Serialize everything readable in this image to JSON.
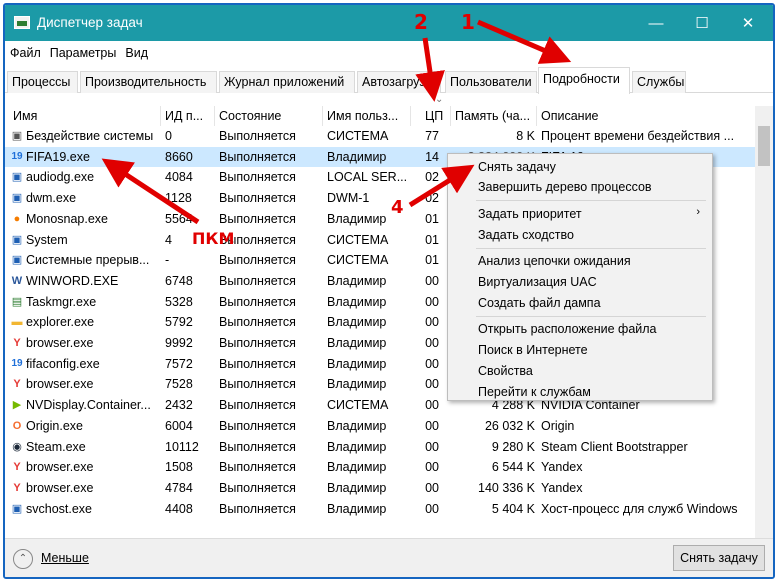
{
  "window": {
    "title": "Диспетчер задач"
  },
  "menu": [
    "Файл",
    "Параметры",
    "Вид"
  ],
  "tabs": [
    "Процессы",
    "Производительность",
    "Журнал приложений",
    "Автозагрузка",
    "Пользователи",
    "Подробности",
    "Службы"
  ],
  "active_tab": "Подробности",
  "columns": {
    "name": "Имя",
    "pid": "ИД п...",
    "state": "Состояние",
    "user": "Имя польз...",
    "cpu": "ЦП",
    "mem": "Память (ча...",
    "desc": "Описание"
  },
  "rows": [
    {
      "name": "Бездействие системы",
      "pid": "0",
      "state": "Выполняется",
      "user": "СИСТЕМА",
      "cpu": "77",
      "mem": "8 K",
      "desc": "Процент времени бездействия ...",
      "icon": "system-idle-icon"
    },
    {
      "name": "FIFA19.exe",
      "pid": "8660",
      "state": "Выполняется",
      "user": "Владимир",
      "cpu": "14",
      "mem": "",
      "desc": "",
      "icon": "fifa-icon"
    },
    {
      "name": "audiodg.exe",
      "pid": "4084",
      "state": "Выполняется",
      "user": "LOCAL SER...",
      "cpu": "02",
      "mem": "",
      "desc": "ойст...",
      "icon": "window-icon"
    },
    {
      "name": "dwm.exe",
      "pid": "1128",
      "state": "Выполняется",
      "user": "DWM-1",
      "cpu": "02",
      "mem": "",
      "desc": "ола",
      "icon": "window-icon"
    },
    {
      "name": "Monosnap.exe",
      "pid": "5564",
      "state": "Выполняется",
      "user": "Владимир",
      "cpu": "01",
      "mem": "",
      "desc": "",
      "icon": "monosnap-icon"
    },
    {
      "name": "System",
      "pid": "4",
      "state": "Выполняется",
      "user": "СИСТЕМА",
      "cpu": "01",
      "mem": "",
      "desc": "",
      "icon": "window-icon"
    },
    {
      "name": "Системные прерыв...",
      "pid": "-",
      "state": "Выполняется",
      "user": "СИСТЕМА",
      "cpu": "01",
      "mem": "",
      "desc": "дур ...",
      "icon": "window-icon"
    },
    {
      "name": "WINWORD.EXE",
      "pid": "6748",
      "state": "Выполняется",
      "user": "Владимир",
      "cpu": "00",
      "mem": "",
      "desc": "",
      "icon": "word-icon"
    },
    {
      "name": "Taskmgr.exe",
      "pid": "5328",
      "state": "Выполняется",
      "user": "Владимир",
      "cpu": "00",
      "mem": "",
      "desc": "",
      "icon": "taskmgr-icon"
    },
    {
      "name": "explorer.exe",
      "pid": "5792",
      "state": "Выполняется",
      "user": "Владимир",
      "cpu": "00",
      "mem": "",
      "desc": "",
      "icon": "folder-icon"
    },
    {
      "name": "browser.exe",
      "pid": "9992",
      "state": "Выполняется",
      "user": "Владимир",
      "cpu": "00",
      "mem": "",
      "desc": "",
      "icon": "yandex-icon"
    },
    {
      "name": "fifaconfig.exe",
      "pid": "7572",
      "state": "Выполняется",
      "user": "Владимир",
      "cpu": "00",
      "mem": "",
      "desc": "",
      "icon": "fifa-icon"
    },
    {
      "name": "browser.exe",
      "pid": "7528",
      "state": "Выполняется",
      "user": "Владимир",
      "cpu": "00",
      "mem": "",
      "desc": "",
      "icon": "yandex-icon"
    },
    {
      "name": "NVDisplay.Container...",
      "pid": "2432",
      "state": "Выполняется",
      "user": "СИСТЕМА",
      "cpu": "00",
      "mem": "4 288 K",
      "desc": "NVIDIA Container",
      "icon": "nvidia-icon"
    },
    {
      "name": "Origin.exe",
      "pid": "6004",
      "state": "Выполняется",
      "user": "Владимир",
      "cpu": "00",
      "mem": "26 032 K",
      "desc": "Origin",
      "icon": "origin-icon"
    },
    {
      "name": "Steam.exe",
      "pid": "10112",
      "state": "Выполняется",
      "user": "Владимир",
      "cpu": "00",
      "mem": "9 280 K",
      "desc": "Steam Client Bootstrapper",
      "icon": "steam-icon"
    },
    {
      "name": "browser.exe",
      "pid": "1508",
      "state": "Выполняется",
      "user": "Владимир",
      "cpu": "00",
      "mem": "6 544 K",
      "desc": "Yandex",
      "icon": "yandex-icon"
    },
    {
      "name": "browser.exe",
      "pid": "4784",
      "state": "Выполняется",
      "user": "Владимир",
      "cpu": "00",
      "mem": "140 336 K",
      "desc": "Yandex",
      "icon": "yandex-icon"
    },
    {
      "name": "svchost.exe",
      "pid": "4408",
      "state": "Выполняется",
      "user": "Владимир",
      "cpu": "00",
      "mem": "5 404 K",
      "desc": "Хост-процесс для служб Windows",
      "icon": "window-icon"
    }
  ],
  "partial_row_1": {
    "mem": "2 224 000 K",
    "desc": "FIFA 19"
  },
  "context_menu": {
    "items": [
      "Снять задачу",
      "Завершить дерево процессов",
      "Задать приоритет",
      "Задать сходство",
      "Анализ цепочки ожидания",
      "Виртуализация UAC",
      "Создать файл дампа",
      "Открыть расположение файла",
      "Поиск в Интернете",
      "Свойства",
      "Перейти к службам"
    ],
    "submenu_arrow": "›"
  },
  "footer": {
    "less_label": "Меньше",
    "end_task_label": "Снять задачу"
  },
  "annotations": {
    "n1": "1",
    "n2": "2",
    "n4": "4",
    "rmb": "ПКМ"
  },
  "colors": {
    "titlebar": "#1c9aa7",
    "selection": "#cce8ff",
    "annotation": "#e00000",
    "frame": "#1565c0"
  }
}
